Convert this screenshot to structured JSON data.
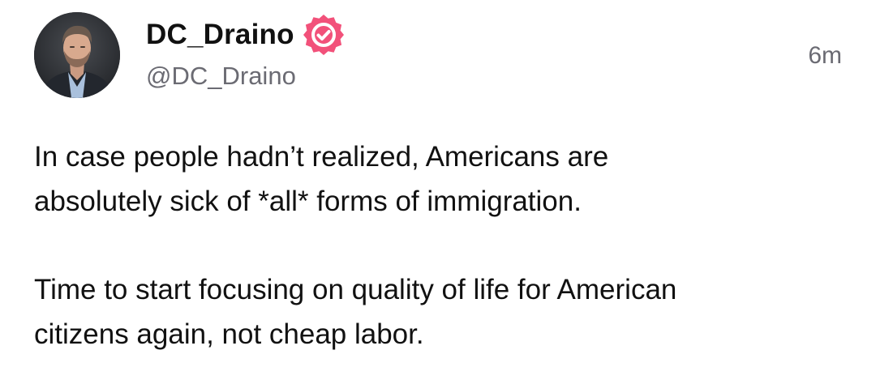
{
  "post": {
    "author": {
      "display_name": "DC_Draino",
      "handle": "@DC_Draino",
      "verified_icon": "verified-badge-icon",
      "avatar": "avatar"
    },
    "timestamp": "6m",
    "paragraphs": [
      "In case people hadn’t realized, Americans are\nabsolutely sick of *all* forms of immigration.",
      "Time to start focusing on quality of life for American\ncitizens again, not cheap labor."
    ]
  },
  "colors": {
    "badge": "#f2517a",
    "text": "#111111",
    "muted": "#6b6b73",
    "background": "#ffffff"
  }
}
